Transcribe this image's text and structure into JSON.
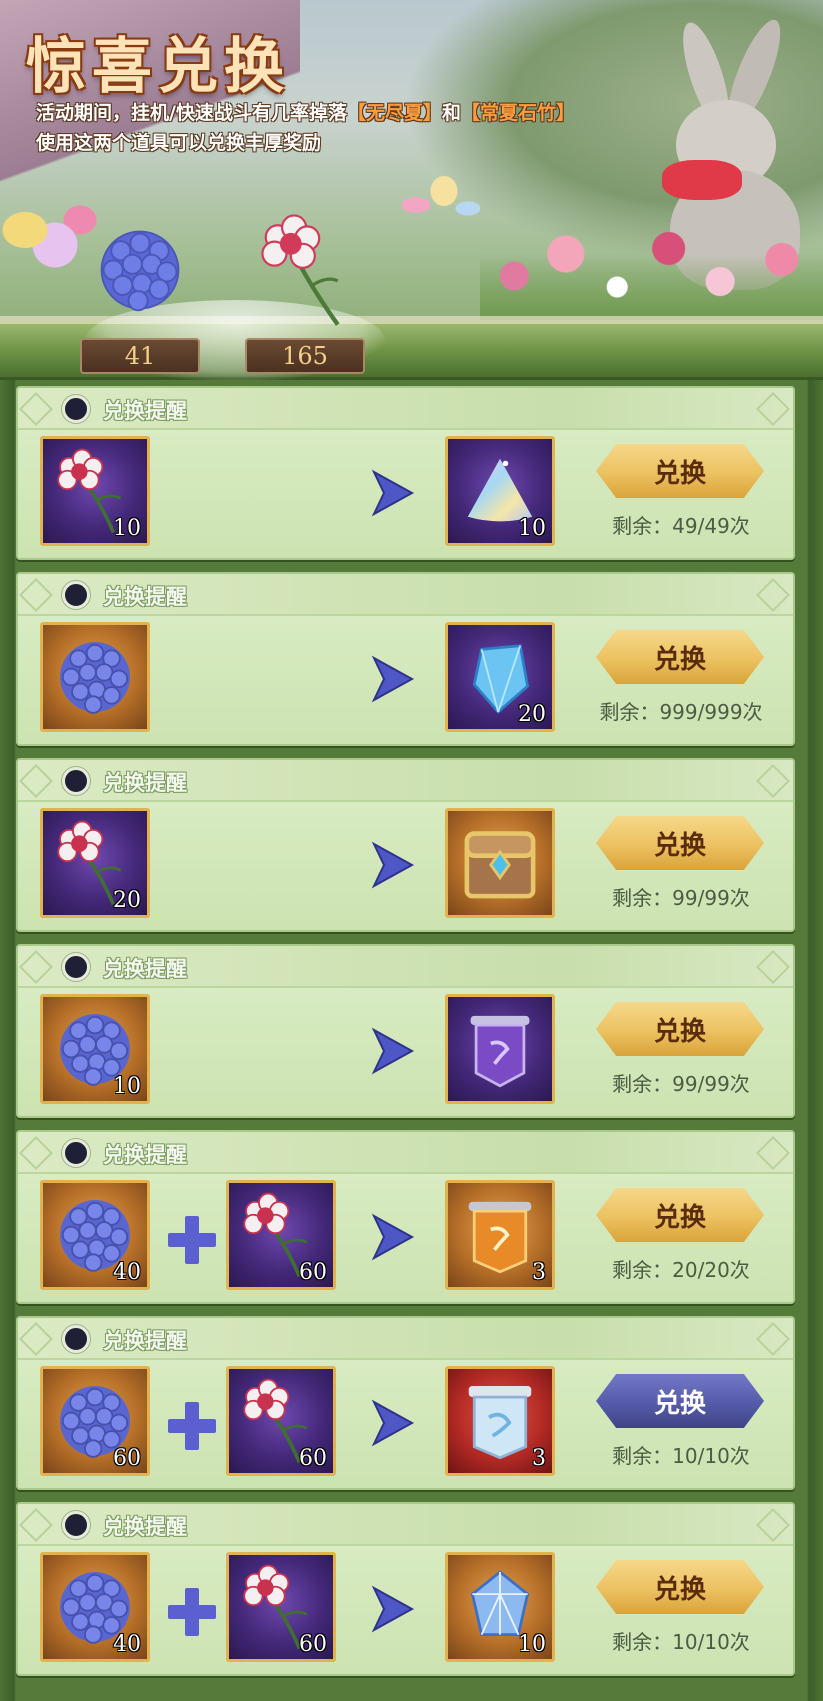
{
  "header": {
    "title": "惊喜兑换",
    "desc_line1_prefix": "活动期间，挂机/快速战斗有几率掉落",
    "desc_item1": "【无尽夏】",
    "desc_line1_mid": "和",
    "desc_item2": "【常夏石竹】",
    "desc_line2": "使用这两个道具可以兑换丰厚奖励"
  },
  "currencies": {
    "hydrangea_count": "41",
    "carnation_count": "165"
  },
  "colors": {
    "button_gold": "#ecc160",
    "button_disabled": "#555ba8",
    "slot_purple": "#432878",
    "slot_orange": "#b56f28",
    "panel_green": "#cfe5b5"
  },
  "rows": [
    {
      "reminder_label": "兑换提醒",
      "cost1": {
        "icon": "carnation-icon",
        "qty": "10"
      },
      "cost2": null,
      "reward": {
        "icon": "rainbow-dust-icon",
        "qty": "10"
      },
      "button": "兑换",
      "remaining": "剩余：49/49次",
      "button_style": "gold"
    },
    {
      "reminder_label": "兑换提醒",
      "cost1": {
        "icon": "hydrangea-icon",
        "qty": ""
      },
      "cost2": null,
      "reward": {
        "icon": "blue-crystal-icon",
        "qty": "20"
      },
      "button": "兑换",
      "remaining": "剩余：999/999次",
      "button_style": "gold"
    },
    {
      "reminder_label": "兑换提醒",
      "cost1": {
        "icon": "carnation-icon",
        "qty": "20"
      },
      "cost2": null,
      "reward": {
        "icon": "treasure-chest-icon",
        "qty": ""
      },
      "button": "兑换",
      "remaining": "剩余：99/99次",
      "button_style": "gold"
    },
    {
      "reminder_label": "兑换提醒",
      "cost1": {
        "icon": "hydrangea-icon",
        "qty": "10"
      },
      "cost2": null,
      "reward": {
        "icon": "purple-scroll-icon",
        "qty": ""
      },
      "button": "兑换",
      "remaining": "剩余：99/99次",
      "button_style": "gold"
    },
    {
      "reminder_label": "兑换提醒",
      "cost1": {
        "icon": "hydrangea-icon",
        "qty": "40"
      },
      "cost2": {
        "icon": "carnation-icon",
        "qty": "60"
      },
      "reward": {
        "icon": "orange-scroll-icon",
        "qty": "3"
      },
      "button": "兑换",
      "remaining": "剩余：20/20次",
      "button_style": "gold"
    },
    {
      "reminder_label": "兑换提醒",
      "cost1": {
        "icon": "hydrangea-icon",
        "qty": "60"
      },
      "cost2": {
        "icon": "carnation-icon",
        "qty": "60"
      },
      "reward": {
        "icon": "silver-scroll-icon",
        "qty": "3"
      },
      "button": "兑换",
      "remaining": "剩余：10/10次",
      "button_style": "dark"
    },
    {
      "reminder_label": "兑换提醒",
      "cost1": {
        "icon": "hydrangea-icon",
        "qty": "40"
      },
      "cost2": {
        "icon": "carnation-icon",
        "qty": "60"
      },
      "reward": {
        "icon": "prism-crystal-icon",
        "qty": "10"
      },
      "button": "兑换",
      "remaining": "剩余：10/10次",
      "button_style": "gold"
    }
  ]
}
